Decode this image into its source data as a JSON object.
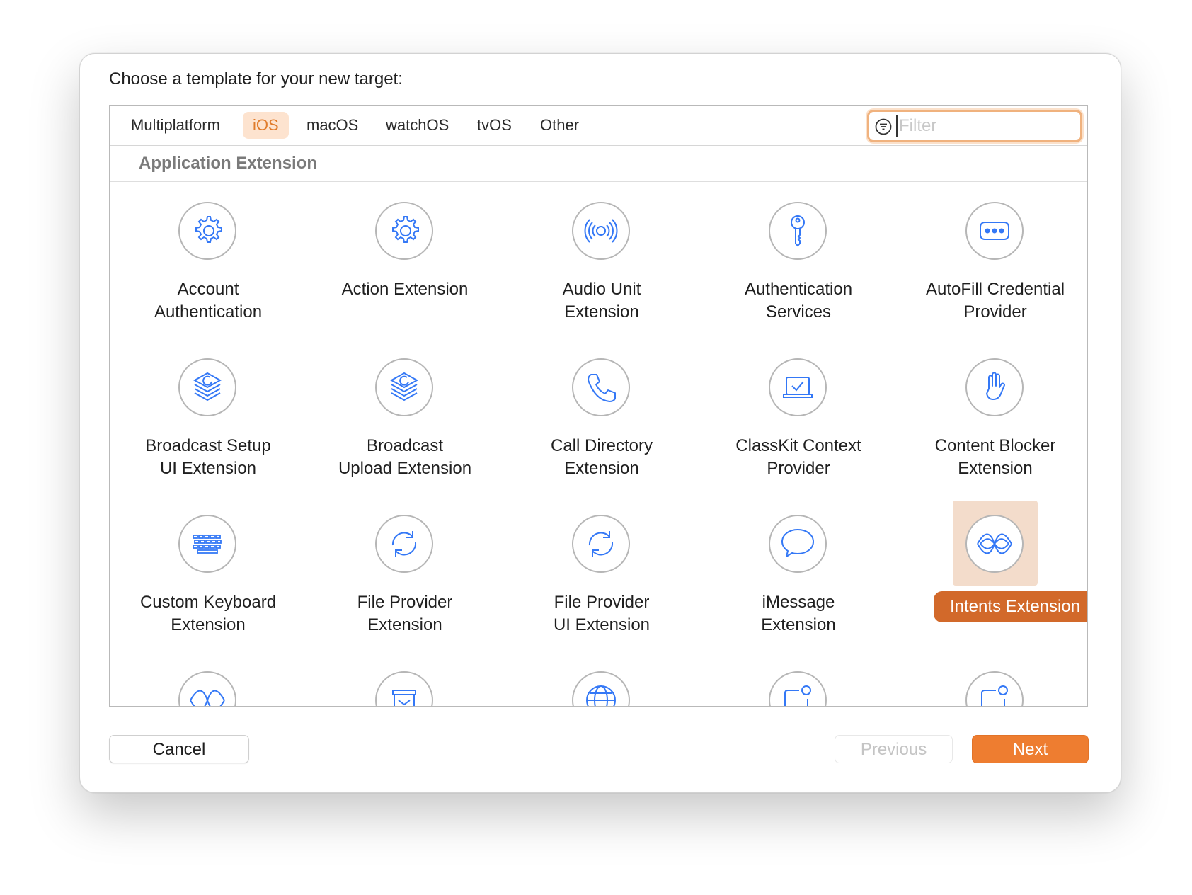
{
  "dialog": {
    "prompt": "Choose a template for your new target:"
  },
  "tabs": [
    {
      "label": "Multiplatform",
      "active": false
    },
    {
      "label": "iOS",
      "active": true
    },
    {
      "label": "macOS",
      "active": false
    },
    {
      "label": "watchOS",
      "active": false
    },
    {
      "label": "tvOS",
      "active": false
    },
    {
      "label": "Other",
      "active": false
    }
  ],
  "filter": {
    "value": "",
    "placeholder": "Filter"
  },
  "section": {
    "title": "Application Extension"
  },
  "templates": [
    {
      "label": "Account\nAuthentication",
      "icon": "gear-icon",
      "selected": false
    },
    {
      "label": "Action Extension",
      "icon": "gear-icon",
      "selected": false
    },
    {
      "label": "Audio Unit\nExtension",
      "icon": "audio-waves-icon",
      "selected": false
    },
    {
      "label": "Authentication\nServices",
      "icon": "key-icon",
      "selected": false
    },
    {
      "label": "AutoFill Credential\nProvider",
      "icon": "password-field-icon",
      "selected": false
    },
    {
      "label": "Broadcast Setup\nUI Extension",
      "icon": "broadcast-stack-icon",
      "selected": false
    },
    {
      "label": "Broadcast\nUpload Extension",
      "icon": "broadcast-stack-icon",
      "selected": false
    },
    {
      "label": "Call Directory\nExtension",
      "icon": "phone-icon",
      "selected": false
    },
    {
      "label": "ClassKit Context\nProvider",
      "icon": "classkit-icon",
      "selected": false
    },
    {
      "label": "Content Blocker\nExtension",
      "icon": "hand-icon",
      "selected": false
    },
    {
      "label": "Custom Keyboard\nExtension",
      "icon": "keyboard-icon",
      "selected": false
    },
    {
      "label": "File Provider\nExtension",
      "icon": "sync-icon",
      "selected": false
    },
    {
      "label": "File Provider\nUI Extension",
      "icon": "sync-icon",
      "selected": false
    },
    {
      "label": "iMessage\nExtension",
      "icon": "speech-bubble-icon",
      "selected": false
    },
    {
      "label": "Intents Extension",
      "icon": "siri-waves-icon",
      "selected": true
    },
    {
      "label": "",
      "icon": "siri-waves-icon",
      "selected": false
    },
    {
      "label": "",
      "icon": "archive-box-icon",
      "selected": false
    },
    {
      "label": "",
      "icon": "globe-icon",
      "selected": false
    },
    {
      "label": "",
      "icon": "notification-icon",
      "selected": false
    },
    {
      "label": "",
      "icon": "notification-icon",
      "selected": false
    }
  ],
  "buttons": {
    "cancel": "Cancel",
    "previous": "Previous",
    "next": "Next"
  },
  "colors": {
    "accent": "#ee7d30",
    "selection": "#d2692a",
    "icon_blue": "#3478f6"
  }
}
